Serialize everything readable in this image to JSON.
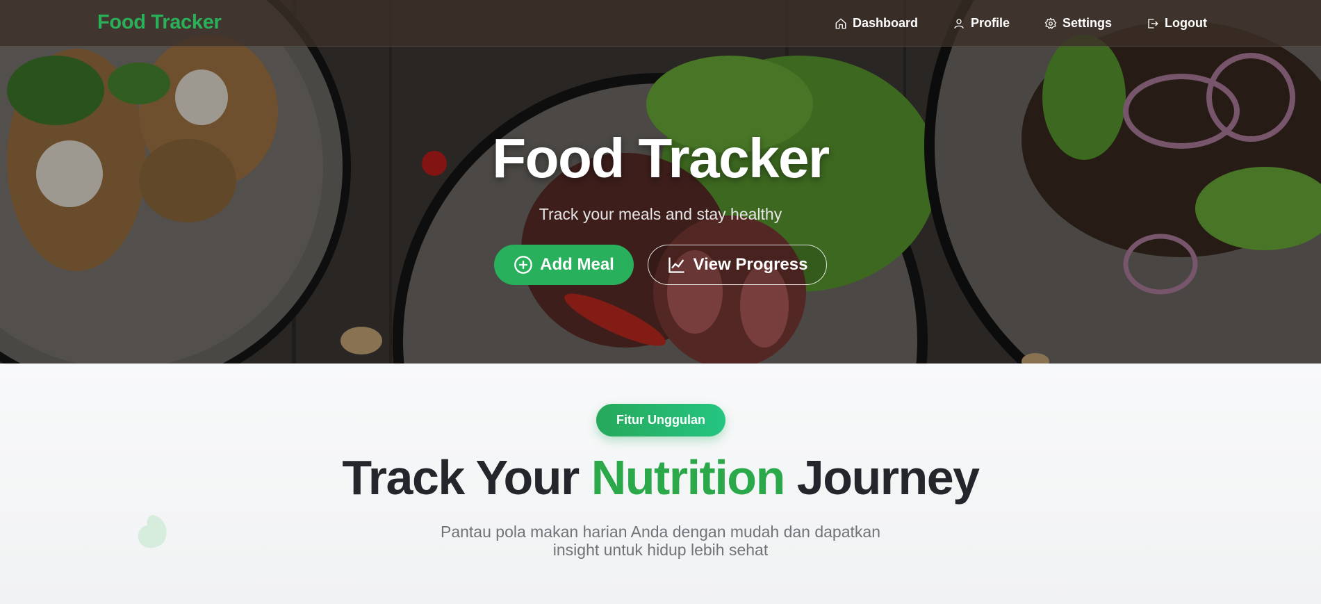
{
  "navbar": {
    "brand": "Food Tracker",
    "items": [
      {
        "label": "Dashboard",
        "icon": "home-icon"
      },
      {
        "label": "Profile",
        "icon": "user-icon"
      },
      {
        "label": "Settings",
        "icon": "gear-icon"
      },
      {
        "label": "Logout",
        "icon": "logout-icon"
      }
    ]
  },
  "hero": {
    "title": "Food Tracker",
    "subtitle": "Track your meals and stay healthy",
    "add_button": {
      "label": "Add Meal",
      "icon": "plus-circle-icon"
    },
    "progress_button": {
      "label": "View Progress",
      "icon": "chart-line-icon"
    }
  },
  "features": {
    "badge": "Fitur Unggulan",
    "title_start": "Track Your ",
    "title_highlight": "Nutrition",
    "title_end": " Journey",
    "description": "Pantau pola makan harian Anda dengan mudah dan dapatkan insight untuk hidup lebih sehat"
  },
  "colors": {
    "accent": "#2bb05a",
    "highlight": "#2aa84a",
    "dark_text": "#24262b"
  }
}
